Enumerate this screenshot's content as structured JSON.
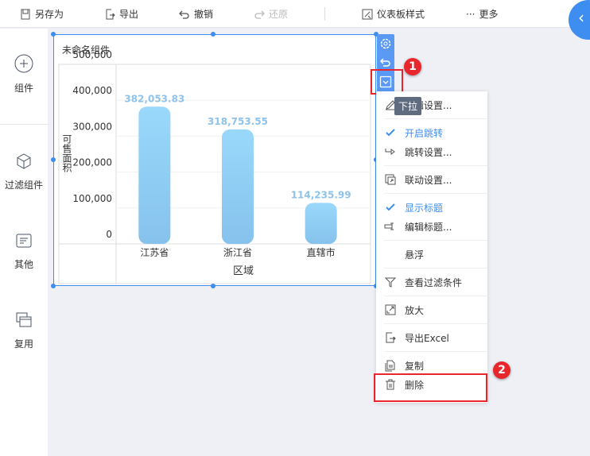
{
  "toolbar": {
    "save_as": "另存为",
    "export": "导出",
    "undo": "撤销",
    "redo": "还原",
    "dashboard_style": "仪表板样式",
    "more": "更多"
  },
  "sidebar": {
    "items": [
      {
        "label": "组件",
        "icon": "plus-circle-icon"
      },
      {
        "label": "过滤组件",
        "icon": "cube-icon"
      },
      {
        "label": "其他",
        "icon": "document-icon"
      },
      {
        "label": "复用",
        "icon": "windows-icon"
      }
    ]
  },
  "widget": {
    "title": "未命名组件",
    "tooltip": "下拉"
  },
  "chart_data": {
    "type": "bar",
    "categories": [
      "江苏省",
      "浙江省",
      "直辖市"
    ],
    "values": [
      382053.83,
      318753.55,
      114235.99
    ],
    "value_labels": [
      "382,053.83",
      "318,753.55",
      "114,235.99"
    ],
    "xlabel": "区域",
    "ylabel": "可售面积",
    "ylim": [
      0,
      500000
    ],
    "yticks": [
      "0",
      "100,000",
      "200,000",
      "300,000",
      "400,000",
      "500,000"
    ],
    "grid": true,
    "bar_color": "#8ecdf3",
    "label_color": "#8fc3ea"
  },
  "menu": {
    "items": [
      {
        "label": "编辑设置...",
        "icon": "pencil-icon"
      },
      {
        "label": "开启跳转",
        "icon": "check-icon",
        "checked": true
      },
      {
        "label": "跳转设置...",
        "icon": "jump-icon"
      },
      {
        "label": "联动设置...",
        "icon": "link-icon"
      },
      {
        "label": "显示标题",
        "icon": "check-icon",
        "checked": true
      },
      {
        "label": "编辑标题...",
        "icon": "title-edit-icon"
      },
      {
        "label": "悬浮",
        "icon": ""
      },
      {
        "label": "查看过滤条件",
        "icon": "filter-icon"
      },
      {
        "label": "放大",
        "icon": "expand-icon"
      },
      {
        "label": "导出Excel",
        "icon": "export-icon"
      },
      {
        "label": "复制",
        "icon": "copy-icon"
      },
      {
        "label": "删除",
        "icon": "trash-icon"
      }
    ]
  },
  "annotations": {
    "step1": "1",
    "step2": "2"
  },
  "colors": {
    "accent": "#3d8ef0",
    "annotation": "#e8262b"
  }
}
